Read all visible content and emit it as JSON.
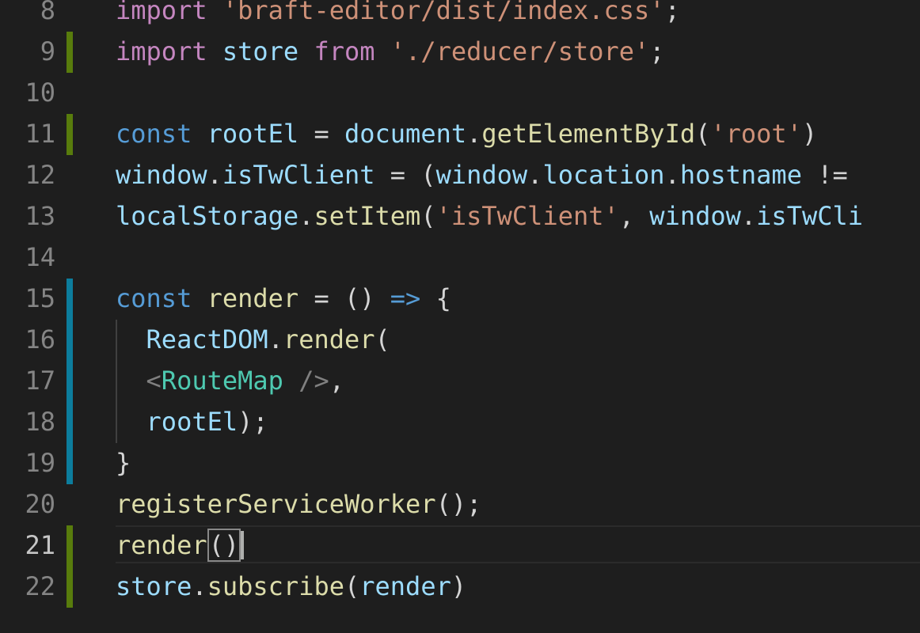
{
  "colors": {
    "background": "#1e1e1e",
    "line_number": "#858585",
    "added_marker": "#587c0c",
    "modified_marker": "#0c7d9d",
    "keyword": "#c586c0",
    "storage": "#569cd6",
    "variable": "#9cdcfe",
    "function": "#dcdcaa",
    "string": "#ce9178",
    "tag": "#4ec9b0"
  },
  "lines": [
    {
      "n": "8",
      "marker": "none",
      "tokens": [
        {
          "t": "import",
          "c": "kw"
        },
        {
          "t": " ",
          "c": "punc"
        },
        {
          "t": "'braft-editor/dist/index.css'",
          "c": "str"
        },
        {
          "t": ";",
          "c": "punc"
        }
      ]
    },
    {
      "n": "9",
      "marker": "added",
      "tokens": [
        {
          "t": "import",
          "c": "kw"
        },
        {
          "t": " ",
          "c": "punc"
        },
        {
          "t": "store",
          "c": "var"
        },
        {
          "t": " ",
          "c": "punc"
        },
        {
          "t": "from",
          "c": "kw"
        },
        {
          "t": " ",
          "c": "punc"
        },
        {
          "t": "'./reducer/store'",
          "c": "str"
        },
        {
          "t": ";",
          "c": "punc"
        }
      ]
    },
    {
      "n": "10",
      "marker": "none",
      "tokens": []
    },
    {
      "n": "11",
      "marker": "added",
      "tokens": [
        {
          "t": "const",
          "c": "storage"
        },
        {
          "t": " ",
          "c": "punc"
        },
        {
          "t": "rootEl",
          "c": "var"
        },
        {
          "t": " = ",
          "c": "punc"
        },
        {
          "t": "document",
          "c": "var"
        },
        {
          "t": ".",
          "c": "punc"
        },
        {
          "t": "getElementById",
          "c": "fn"
        },
        {
          "t": "(",
          "c": "punc"
        },
        {
          "t": "'root'",
          "c": "str"
        },
        {
          "t": ")",
          "c": "punc"
        }
      ]
    },
    {
      "n": "12",
      "marker": "none",
      "tokens": [
        {
          "t": "window",
          "c": "var"
        },
        {
          "t": ".",
          "c": "punc"
        },
        {
          "t": "isTwClient",
          "c": "var"
        },
        {
          "t": " = (",
          "c": "punc"
        },
        {
          "t": "window",
          "c": "var"
        },
        {
          "t": ".",
          "c": "punc"
        },
        {
          "t": "location",
          "c": "var"
        },
        {
          "t": ".",
          "c": "punc"
        },
        {
          "t": "hostname",
          "c": "var"
        },
        {
          "t": " !=",
          "c": "punc"
        }
      ]
    },
    {
      "n": "13",
      "marker": "none",
      "tokens": [
        {
          "t": "localStorage",
          "c": "var"
        },
        {
          "t": ".",
          "c": "punc"
        },
        {
          "t": "setItem",
          "c": "fn"
        },
        {
          "t": "(",
          "c": "punc"
        },
        {
          "t": "'isTwClient'",
          "c": "str"
        },
        {
          "t": ", ",
          "c": "punc"
        },
        {
          "t": "window",
          "c": "var"
        },
        {
          "t": ".",
          "c": "punc"
        },
        {
          "t": "isTwCli",
          "c": "var"
        }
      ]
    },
    {
      "n": "14",
      "marker": "none",
      "tokens": []
    },
    {
      "n": "15",
      "marker": "modified",
      "tokens": [
        {
          "t": "const",
          "c": "storage"
        },
        {
          "t": " ",
          "c": "punc"
        },
        {
          "t": "render",
          "c": "fn"
        },
        {
          "t": " = () ",
          "c": "punc"
        },
        {
          "t": "=>",
          "c": "storage"
        },
        {
          "t": " {",
          "c": "punc"
        }
      ]
    },
    {
      "n": "16",
      "marker": "modified",
      "guide": true,
      "tokens": [
        {
          "t": "  ",
          "c": "punc"
        },
        {
          "t": "ReactDOM",
          "c": "var"
        },
        {
          "t": ".",
          "c": "punc"
        },
        {
          "t": "render",
          "c": "fn"
        },
        {
          "t": "(",
          "c": "punc"
        }
      ]
    },
    {
      "n": "17",
      "marker": "modified",
      "guide": true,
      "tokens": [
        {
          "t": "  ",
          "c": "punc"
        },
        {
          "t": "<",
          "c": "tagbr"
        },
        {
          "t": "RouteMap",
          "c": "tag"
        },
        {
          "t": " />",
          "c": "tagbr"
        },
        {
          "t": ",",
          "c": "punc"
        }
      ]
    },
    {
      "n": "18",
      "marker": "modified",
      "guide": true,
      "tokens": [
        {
          "t": "  ",
          "c": "punc"
        },
        {
          "t": "rootEl",
          "c": "var"
        },
        {
          "t": ");",
          "c": "punc"
        }
      ]
    },
    {
      "n": "19",
      "marker": "modified",
      "tokens": [
        {
          "t": "}",
          "c": "punc"
        }
      ]
    },
    {
      "n": "20",
      "marker": "none",
      "tokens": [
        {
          "t": "registerServiceWorker",
          "c": "fn"
        },
        {
          "t": "();",
          "c": "punc"
        }
      ]
    },
    {
      "n": "21",
      "marker": "added",
      "current": true,
      "tokens": [
        {
          "t": "render",
          "c": "fn"
        },
        {
          "t": "()",
          "c": "punc",
          "match": true
        },
        {
          "t": "",
          "c": "caret"
        }
      ]
    },
    {
      "n": "22",
      "marker": "added",
      "tokens": [
        {
          "t": "store",
          "c": "var"
        },
        {
          "t": ".",
          "c": "punc"
        },
        {
          "t": "subscribe",
          "c": "fn"
        },
        {
          "t": "(",
          "c": "punc"
        },
        {
          "t": "render",
          "c": "var"
        },
        {
          "t": ")",
          "c": "punc"
        }
      ]
    }
  ]
}
